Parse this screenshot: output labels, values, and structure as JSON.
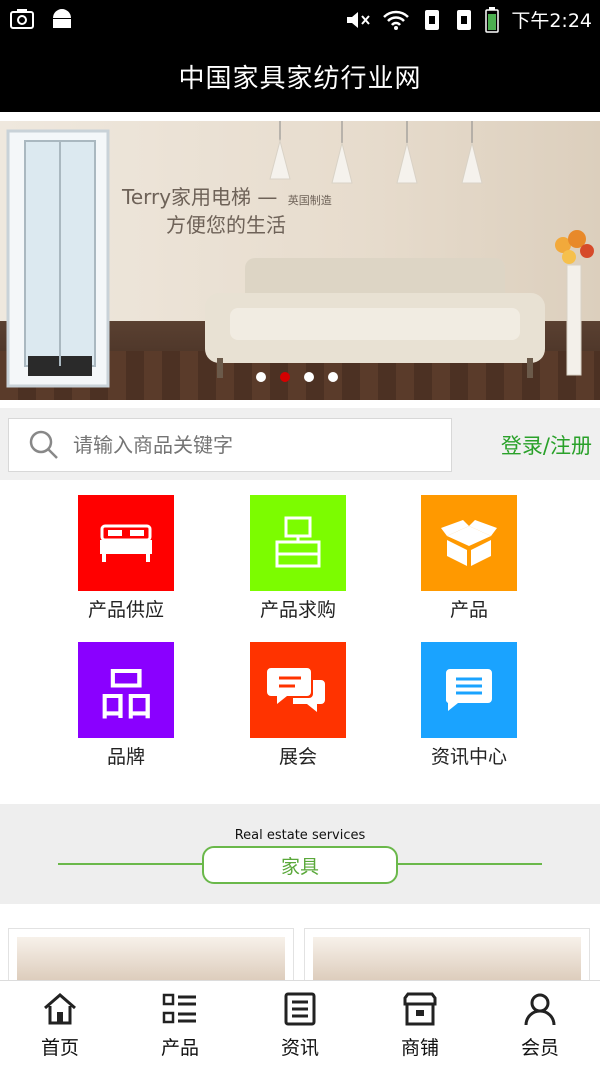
{
  "status_bar": {
    "time": "下午2:24"
  },
  "app": {
    "title": "中国家具家纺行业网"
  },
  "banner": {
    "line1": "Terry家用电梯 —",
    "flag_tag": "英国制造",
    "line2": "方便您的生活",
    "dot_count": 4,
    "active_dot": 1
  },
  "search": {
    "placeholder": "请输入商品关键字",
    "login_label": "登录/注册"
  },
  "categories": [
    {
      "label": "产品供应",
      "color": "#ff0000",
      "icon": "bed-icon"
    },
    {
      "label": "产品求购",
      "color": "#7cfc00",
      "icon": "tv-cabinet-icon"
    },
    {
      "label": "产品",
      "color": "#ff9900",
      "icon": "box-icon"
    },
    {
      "label": "品牌",
      "color": "#8a00ff",
      "icon": "brand-glyph-icon",
      "glyph": "品"
    },
    {
      "label": "展会",
      "color": "#ff3300",
      "icon": "chat-bubbles-icon"
    },
    {
      "label": "资讯中心",
      "color": "#1aa3ff",
      "icon": "message-icon"
    }
  ],
  "section": {
    "subtitle": "Real estate services",
    "title": "家具"
  },
  "bottom_nav": [
    {
      "label": "首页",
      "icon": "home-icon"
    },
    {
      "label": "产品",
      "icon": "list-icon"
    },
    {
      "label": "资讯",
      "icon": "news-icon"
    },
    {
      "label": "商铺",
      "icon": "shop-icon"
    },
    {
      "label": "会员",
      "icon": "user-icon"
    }
  ]
}
